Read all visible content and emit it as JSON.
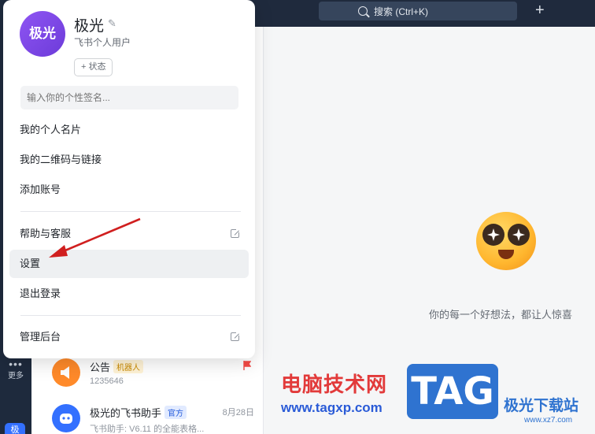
{
  "topbar": {
    "search_placeholder": "搜索 (Ctrl+K)",
    "new_button": "+"
  },
  "rail": {
    "more_icon": "•••",
    "more_label": "更多",
    "me_badge": "极"
  },
  "profile": {
    "avatar_text": "极光",
    "name": "极光",
    "edit_icon": "✎",
    "account_type": "飞书个人用户",
    "status_button": "+ 状态",
    "signature_placeholder": "输入你的个性签名..."
  },
  "menu": {
    "items": [
      "我的个人名片",
      "我的二维码与链接",
      "添加账号",
      "帮助与客服",
      "设置",
      "退出登录",
      "管理后台"
    ],
    "highlighted": "设置"
  },
  "chats": [
    {
      "name": "公告",
      "tag": "机器人",
      "preview": "1235646",
      "date": ""
    },
    {
      "name": "极光的飞书助手",
      "tag": "官方",
      "preview": "飞书助手: V6.11 的全能表格...",
      "date": "8月28日"
    }
  ],
  "main": {
    "tagline": "你的每一个好想法，都让人惊喜"
  },
  "watermark": {
    "cn": "电脑技术网",
    "url": "www.tagxp.com",
    "tag": "TAG",
    "site": "极光下载站",
    "site_url": "www.xz7.com"
  },
  "colors": {
    "accent": "#3370ff",
    "arrow": "#d01f1f",
    "avatar": "#7a45e8"
  }
}
